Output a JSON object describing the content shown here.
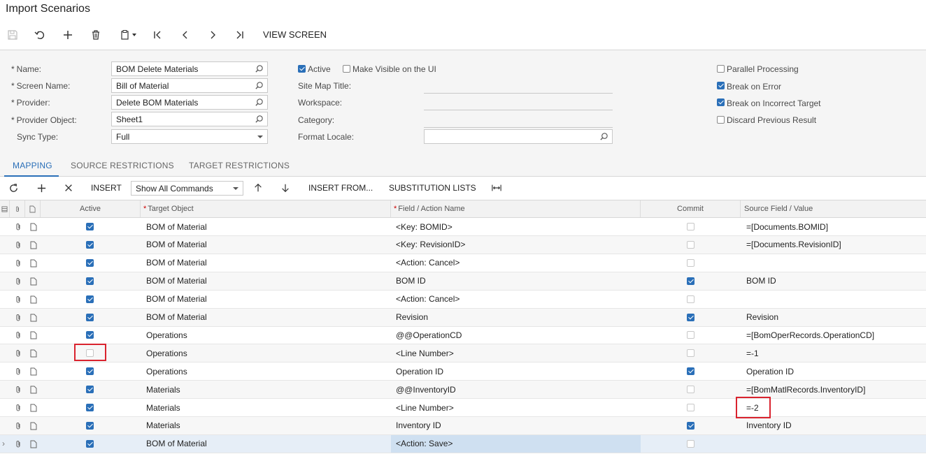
{
  "title": "Import Scenarios",
  "toolbar": {
    "view_screen": "VIEW SCREEN"
  },
  "form": {
    "name_label": "Name:",
    "name_value": "BOM Delete Materials",
    "screen_label": "Screen Name:",
    "screen_value": "Bill of Material",
    "provider_label": "Provider:",
    "provider_value": "Delete BOM Materials",
    "provider_object_label": "Provider Object:",
    "provider_object_value": "Sheet1",
    "sync_label": "Sync Type:",
    "sync_value": "Full",
    "active_label": "Active",
    "active_checked": true,
    "visible_label": "Make Visible on the UI",
    "visible_checked": false,
    "sitemap_label": "Site Map Title:",
    "workspace_label": "Workspace:",
    "category_label": "Category:",
    "locale_label": "Format Locale:",
    "parallel_label": "Parallel Processing",
    "parallel_checked": false,
    "break_error_label": "Break on Error",
    "break_error_checked": true,
    "break_target_label": "Break on Incorrect Target",
    "break_target_checked": true,
    "discard_label": "Discard Previous Result",
    "discard_checked": false
  },
  "tabs": [
    "MAPPING",
    "SOURCE RESTRICTIONS",
    "TARGET RESTRICTIONS"
  ],
  "gridbar": {
    "insert": "INSERT",
    "commands_select": "Show All Commands",
    "insert_from": "INSERT FROM...",
    "substitution_lists": "SUBSTITUTION LISTS"
  },
  "columns": {
    "active": "Active",
    "target_object": "Target Object",
    "field_action": "Field / Action Name",
    "commit": "Commit",
    "source": "Source Field / Value"
  },
  "rows": [
    {
      "active": true,
      "target": "BOM of Material",
      "field": "<Key: BOMID>",
      "commit": false,
      "source": "=[Documents.BOMID]"
    },
    {
      "active": true,
      "target": "BOM of Material",
      "field": "<Key: RevisionID>",
      "commit": false,
      "source": "=[Documents.RevisionID]"
    },
    {
      "active": true,
      "target": "BOM of Material",
      "field": "<Action: Cancel>",
      "commit": false,
      "source": ""
    },
    {
      "active": true,
      "target": "BOM of Material",
      "field": "BOM ID",
      "commit": true,
      "source": "BOM ID"
    },
    {
      "active": true,
      "target": "BOM of Material",
      "field": "<Action: Cancel>",
      "commit": false,
      "source": ""
    },
    {
      "active": true,
      "target": "BOM of Material",
      "field": "Revision",
      "commit": true,
      "source": "Revision"
    },
    {
      "active": true,
      "target": "Operations",
      "field": "@@OperationCD",
      "commit": false,
      "source": "=[BomOperRecords.OperationCD]"
    },
    {
      "active": false,
      "target": "Operations",
      "field": "<Line Number>",
      "commit": false,
      "source": "=-1"
    },
    {
      "active": true,
      "target": "Operations",
      "field": "Operation ID",
      "commit": true,
      "source": "Operation ID"
    },
    {
      "active": true,
      "target": "Materials",
      "field": "@@InventoryID",
      "commit": false,
      "source": "=[BomMatlRecords.InventoryID]"
    },
    {
      "active": true,
      "target": "Materials",
      "field": "<Line Number>",
      "commit": false,
      "source": "=-2"
    },
    {
      "active": true,
      "target": "Materials",
      "field": "Inventory ID",
      "commit": true,
      "source": "Inventory ID"
    },
    {
      "active": true,
      "target": "BOM of Material",
      "field": "<Action: Save>",
      "commit": false,
      "source": ""
    }
  ]
}
